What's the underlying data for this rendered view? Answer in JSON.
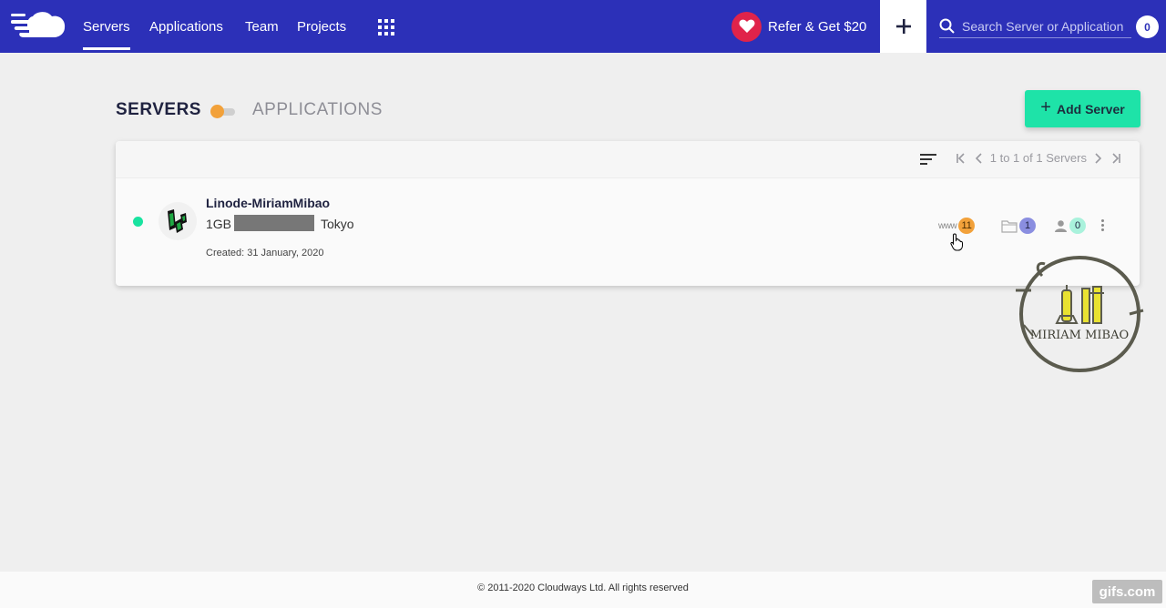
{
  "nav": {
    "items": [
      {
        "label": "Servers",
        "active": true
      },
      {
        "label": "Applications"
      },
      {
        "label": "Team"
      },
      {
        "label": "Projects"
      }
    ],
    "refer_label": "Refer & Get $20",
    "search_placeholder": "Search Server or Application",
    "notification_count": "0"
  },
  "page": {
    "servers_heading": "SERVERS",
    "applications_heading": "APPLICATIONS",
    "add_server_label": "Add Server"
  },
  "list": {
    "pagination_text": "1 to 1 of 1 Servers"
  },
  "server": {
    "name": "Linode-MiriamMibao",
    "size": "1GB",
    "location": "Tokyo",
    "created": "Created: 31 January, 2020",
    "status": "running",
    "www_label": "www",
    "apps_count": "11",
    "projects_count": "1",
    "team_count": "0"
  },
  "watermark": {
    "text": "MIRIAM MIBAO"
  },
  "footer": {
    "copyright": "© 2011-2020 Cloudways Ltd. All rights reserved",
    "gifs_badge": "gifs.com"
  },
  "colors": {
    "topbar": "#2c30b8",
    "accent_green": "#1ee3a8",
    "status_green": "#19e3a0",
    "apps_badge": "#f2a13a",
    "projects_badge": "#8a8ee0",
    "team_badge": "#a9f2dc",
    "heart": "#e0234a"
  }
}
